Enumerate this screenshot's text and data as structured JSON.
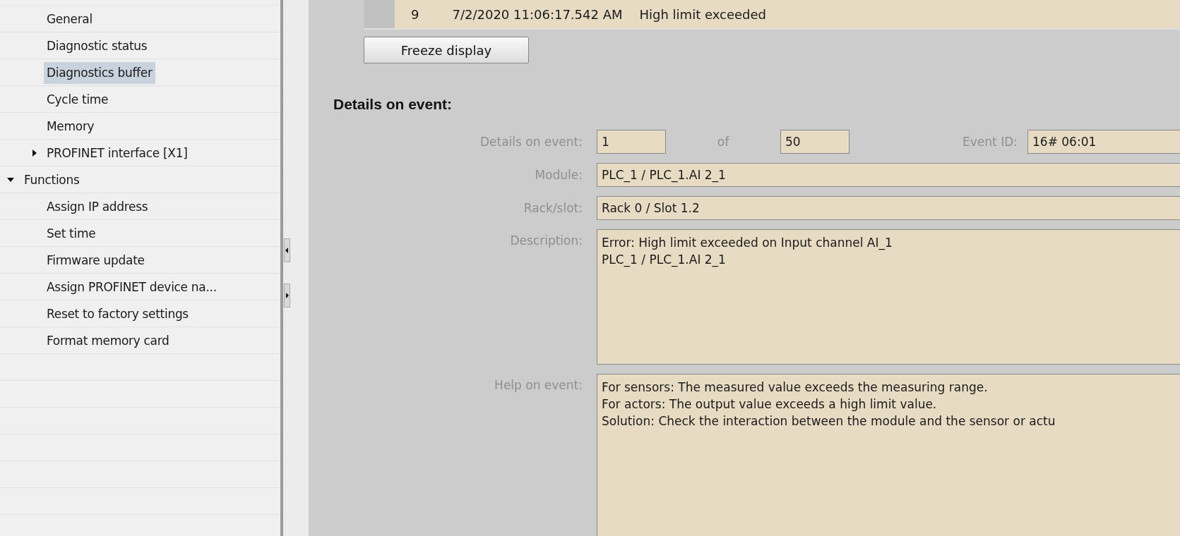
{
  "sidebar": {
    "continued_items": [
      {
        "label": "General",
        "selected": false
      },
      {
        "label": "Diagnostic status",
        "selected": false
      },
      {
        "label": "Diagnostics buffer",
        "selected": true
      },
      {
        "label": "Cycle time",
        "selected": false
      },
      {
        "label": "Memory",
        "selected": false
      },
      {
        "label": "PROFINET interface [X1]",
        "selected": false,
        "expanded": false
      }
    ],
    "items": [
      {
        "label": "Functions",
        "selected": false,
        "expanded": true,
        "children": [
          {
            "label": "Assign IP address",
            "selected": false
          },
          {
            "label": "Set time",
            "selected": false
          },
          {
            "label": "Firmware update",
            "selected": false
          },
          {
            "label": "Assign PROFINET device na...",
            "selected": false
          },
          {
            "label": "Reset to factory settings",
            "selected": false
          },
          {
            "label": "Format memory card",
            "selected": false
          }
        ]
      }
    ]
  },
  "buffer_row": {
    "number": "9",
    "timestamp": "7/2/2020 11:06:17.542 AM",
    "event": "High limit exceeded"
  },
  "freeze_button": "Freeze display",
  "details": {
    "heading": "Details on event:",
    "event_counter": {
      "label": "Details on event:",
      "current": "1",
      "of": "of",
      "total": "50"
    },
    "event_id": {
      "label": "Event ID:",
      "value": "16# 06:01"
    },
    "fields": [
      {
        "kind": "line",
        "label": "Module:",
        "value": "PLC_1 / PLC_1.AI 2_1"
      },
      {
        "kind": "line",
        "label": "Rack/slot:",
        "value": "Rack 0 / Slot 1.2"
      },
      {
        "kind": "area",
        "label": "Description:",
        "lines": [
          "Error: High limit exceeded on Input channel AI_1",
          "PLC_1 / PLC_1.AI 2_1"
        ]
      },
      {
        "kind": "area",
        "label": "Help on event:",
        "lines": [
          "For sensors: The measured value exceeds the measuring range.",
          "For actors: The output value exceeds a high limit value.",
          "Solution: Check the interaction between the module and the sensor or actu"
        ]
      }
    ]
  }
}
